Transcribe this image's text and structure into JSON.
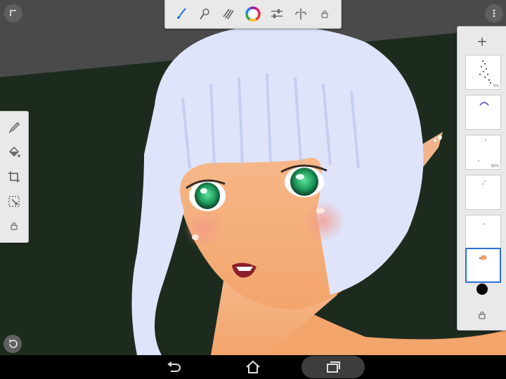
{
  "app": {
    "colors": {
      "canvas_bg": "#1d2b1f",
      "wall_gray": "#4a4a4a",
      "panel_bg": "#e9e9e9",
      "icon_gray": "#6b6b6b",
      "brush_blue": "#2a6fdc",
      "active_layer_border": "#2a6fdc",
      "hair": "#dfe4fb",
      "skin": "#f2b48d",
      "eye_green": "#1e9a5c",
      "current_color": "#000000"
    }
  },
  "top_toolbar": {
    "tools": [
      "brush-icon",
      "brush-settings-icon",
      "brush-library-icon",
      "color-wheel-icon",
      "adjustments-icon",
      "symmetry-icon",
      "lock-icon"
    ]
  },
  "left_toolbar": {
    "tools": [
      "eyedropper-icon",
      "fill-bucket-icon",
      "crop-icon",
      "transform-selection-icon",
      "lock-icon"
    ]
  },
  "layers": {
    "add_label": "+",
    "items": [
      {
        "name": "layer-1",
        "opacity_label": "5%"
      },
      {
        "name": "layer-2",
        "opacity_label": ""
      },
      {
        "name": "layer-3",
        "opacity_label": "92%"
      },
      {
        "name": "layer-4",
        "opacity_label": ""
      },
      {
        "name": "layer-5",
        "opacity_label": ""
      },
      {
        "name": "layer-6",
        "opacity_label": "",
        "active": true
      }
    ]
  },
  "navbar": {
    "buttons": [
      "back-icon",
      "home-icon",
      "recents-icon"
    ]
  }
}
